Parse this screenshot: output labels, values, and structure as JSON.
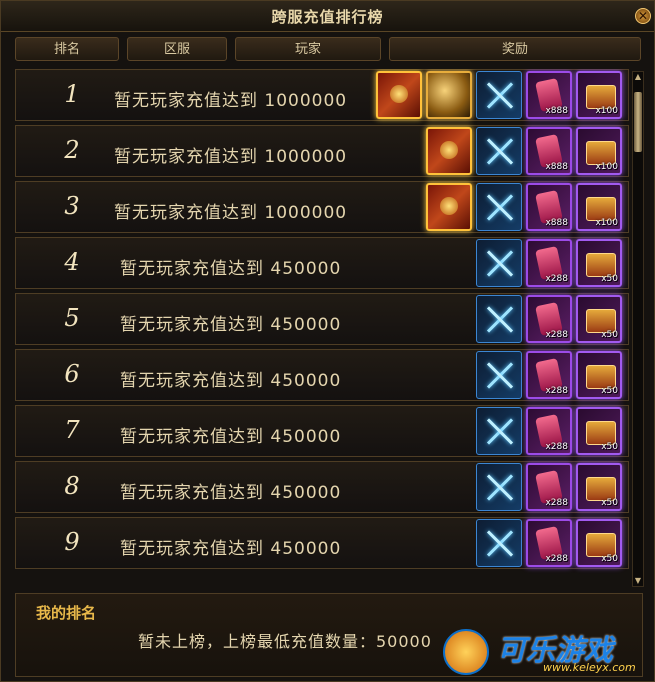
{
  "window": {
    "title": "跨服充值排行榜",
    "close_icon": "close-icon"
  },
  "header": {
    "rank": "排名",
    "server": "区服",
    "player": "玩家",
    "reward": "奖励"
  },
  "rows": [
    {
      "rank": "1",
      "text": "暂无玩家充值达到 1000000",
      "items": [
        {
          "type": "card",
          "qty": ""
        },
        {
          "type": "orb",
          "qty": ""
        },
        {
          "type": "sword",
          "qty": ""
        },
        {
          "type": "pink",
          "qty": "x888"
        },
        {
          "type": "chest",
          "qty": "x100"
        }
      ]
    },
    {
      "rank": "2",
      "text": "暂无玩家充值达到 1000000",
      "items": [
        {
          "type": "card",
          "qty": ""
        },
        {
          "type": "sword",
          "qty": ""
        },
        {
          "type": "pink",
          "qty": "x888"
        },
        {
          "type": "chest",
          "qty": "x100"
        }
      ]
    },
    {
      "rank": "3",
      "text": "暂无玩家充值达到 1000000",
      "items": [
        {
          "type": "card",
          "qty": ""
        },
        {
          "type": "sword",
          "qty": ""
        },
        {
          "type": "pink",
          "qty": "x888"
        },
        {
          "type": "chest",
          "qty": "x100"
        }
      ]
    },
    {
      "rank": "4",
      "text": "暂无玩家充值达到 450000",
      "items": [
        {
          "type": "sword",
          "qty": ""
        },
        {
          "type": "pink",
          "qty": "x288"
        },
        {
          "type": "chest",
          "qty": "x50"
        }
      ]
    },
    {
      "rank": "5",
      "text": "暂无玩家充值达到 450000",
      "items": [
        {
          "type": "sword",
          "qty": ""
        },
        {
          "type": "pink",
          "qty": "x288"
        },
        {
          "type": "chest",
          "qty": "x50"
        }
      ]
    },
    {
      "rank": "6",
      "text": "暂无玩家充值达到 450000",
      "items": [
        {
          "type": "sword",
          "qty": ""
        },
        {
          "type": "pink",
          "qty": "x288"
        },
        {
          "type": "chest",
          "qty": "x50"
        }
      ]
    },
    {
      "rank": "7",
      "text": "暂无玩家充值达到 450000",
      "items": [
        {
          "type": "sword",
          "qty": ""
        },
        {
          "type": "pink",
          "qty": "x288"
        },
        {
          "type": "chest",
          "qty": "x50"
        }
      ]
    },
    {
      "rank": "8",
      "text": "暂无玩家充值达到 450000",
      "items": [
        {
          "type": "sword",
          "qty": ""
        },
        {
          "type": "pink",
          "qty": "x288"
        },
        {
          "type": "chest",
          "qty": "x50"
        }
      ]
    },
    {
      "rank": "9",
      "text": "暂无玩家充值达到 450000",
      "items": [
        {
          "type": "sword",
          "qty": ""
        },
        {
          "type": "pink",
          "qty": "x288"
        },
        {
          "type": "chest",
          "qty": "x50"
        }
      ]
    }
  ],
  "my_rank": {
    "title": "我的排名",
    "text": "暂未上榜，上榜最低充值数量：50000"
  },
  "watermark": {
    "brand": "可乐游戏",
    "url": "www.keleyx.com"
  },
  "colors": {
    "accent": "#e8b84a",
    "text": "#e4d5ae",
    "border": "#4e3d24"
  }
}
